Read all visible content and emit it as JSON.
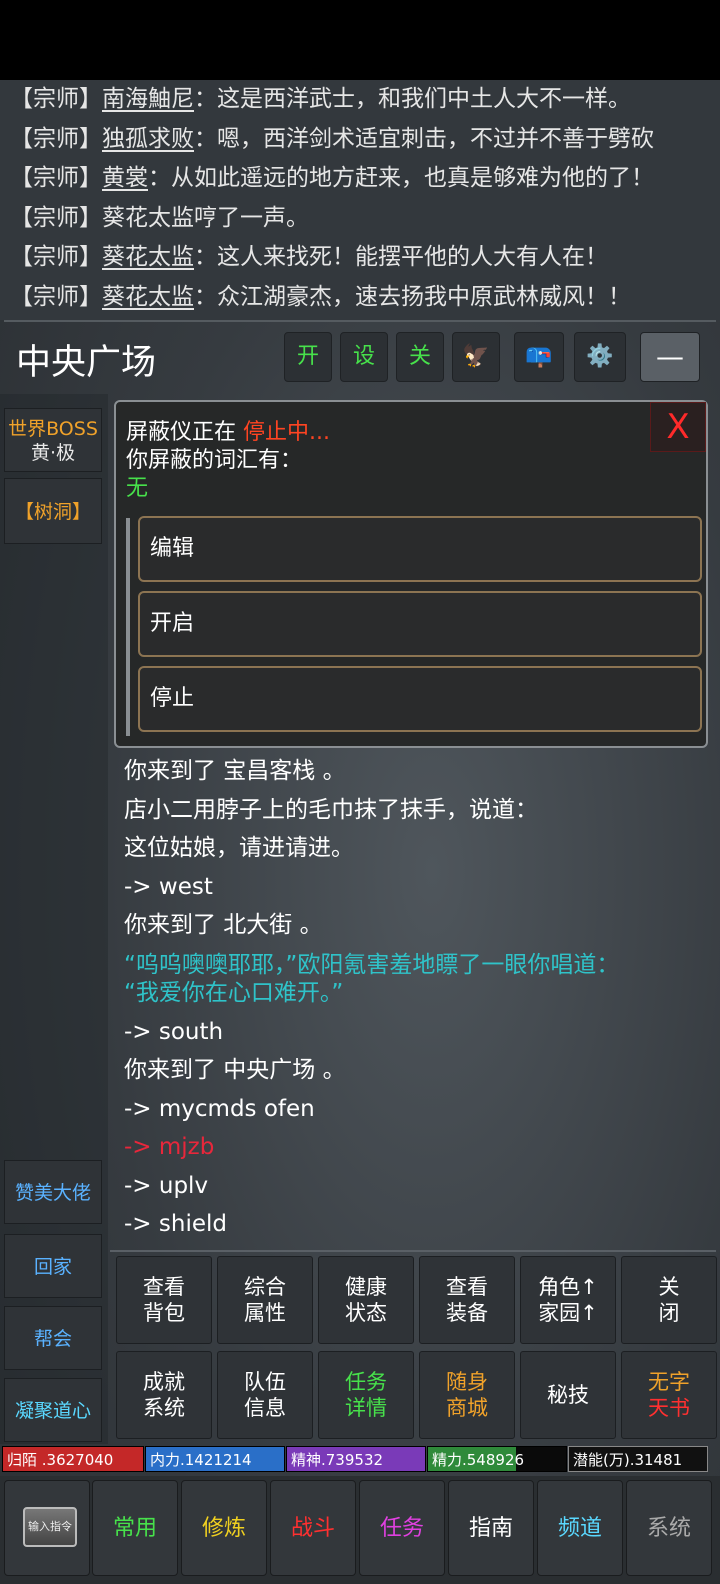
{
  "chat": [
    {
      "tag": "【宗师】",
      "who": "南海鮋尼",
      "text": "：这是西洋武士，和我们中土人大不一样。"
    },
    {
      "tag": "【宗师】",
      "who": "独孤求败",
      "text": "：嗯，西洋剑术适宜刺击，不过并不善于劈砍"
    },
    {
      "tag": "【宗师】",
      "who": "黄裳",
      "text": "：从如此遥远的地方赶来，也真是够难为他的了！"
    },
    {
      "tag": "【宗师】",
      "who": "",
      "text": "葵花太监哼了一声。"
    },
    {
      "tag": "【宗师】",
      "who": "葵花太监",
      "text": "：这人来找死！能摆平他的人大有人在！"
    },
    {
      "tag": "【宗师】",
      "who": "葵花太监",
      "text": "：众江湖豪杰，速去扬我中原武林威风！！"
    }
  ],
  "header": {
    "title": "中央广场",
    "btn_open": "开",
    "btn_settings": "设",
    "btn_close": "关",
    "btn_eagle_icon": "🦅",
    "btn_mail_icon": "📪",
    "btn_gear_icon": "⚙️",
    "btn_minimize": "—"
  },
  "left": {
    "boss_line1": "世界BOSS",
    "boss_line2": "黄·极",
    "tree": "【树洞】",
    "praise": "赞美大佬",
    "home": "回家",
    "guild": "帮会",
    "heart": "凝聚道心"
  },
  "dialog": {
    "close": "X",
    "status_prefix": "屏蔽仪正在 ",
    "status": "停止中...",
    "words_label": "你屏蔽的词汇有：",
    "words": "无",
    "buttons": [
      "编辑",
      "开启",
      "停止"
    ]
  },
  "log": {
    "l1": "你来到了 宝昌客栈 。",
    "l2": "店小二用脖子上的毛巾抹了抹手，说道：",
    "l3": "这位姑娘，请进请进。",
    "l4": "-> west",
    "l5": "你来到了 北大街 。",
    "l6": "“呜呜噢噢耶耶，”欧阳氪害羞地瞟了一眼你唱道：",
    "l7": "“我爱你在心口难开。”",
    "l8": "-> south",
    "l9": "你来到了 中央广场 。",
    "l10": "-> mycmds ofen",
    "l11": "-> mjzb",
    "l12": "-> uplv",
    "l13": "-> shield"
  },
  "grid": {
    "r1": [
      {
        "a": "查看",
        "b": "背包"
      },
      {
        "a": "综合",
        "b": "属性"
      },
      {
        "a": "健康",
        "b": "状态"
      },
      {
        "a": "查看",
        "b": "装备"
      },
      {
        "a": "角色↑",
        "b": "家园↑"
      },
      {
        "a": "关",
        "b": "闭"
      }
    ],
    "r2": [
      {
        "a": "成就",
        "b": "系统"
      },
      {
        "a": "队伍",
        "b": "信息"
      },
      {
        "a": "任务",
        "b": "详情"
      },
      {
        "a": "随身",
        "b": "商城"
      },
      {
        "a": "秘技",
        "b": ""
      },
      {
        "a": "无字",
        "b": "天书"
      }
    ]
  },
  "stats": {
    "hp": {
      "label": "归陌 .3627040",
      "fill": 1.0,
      "color": "#c42828"
    },
    "neili": {
      "label": "内力.1421214",
      "fill": 1.0,
      "color": "#2a6fc8"
    },
    "jingshen": {
      "label": "精神.739532",
      "fill": 1.0,
      "color": "#7a3ab8"
    },
    "jingli": {
      "label": "精力.548926",
      "fill": 0.64,
      "color": "#2f8a3a"
    },
    "qianneng": {
      "label": "潜能(万).31481"
    }
  },
  "nav": {
    "input": "输入指令",
    "common": "常用",
    "train": "修炼",
    "fight": "战斗",
    "task": "任务",
    "guide": "指南",
    "channel": "频道",
    "system": "系统"
  },
  "colors": {
    "accent_green": "#47e14b",
    "accent_orange": "#f0a22a",
    "accent_red": "#ff3030",
    "accent_cyan": "#2fc3c9",
    "accent_blue": "#5ab2ff"
  }
}
